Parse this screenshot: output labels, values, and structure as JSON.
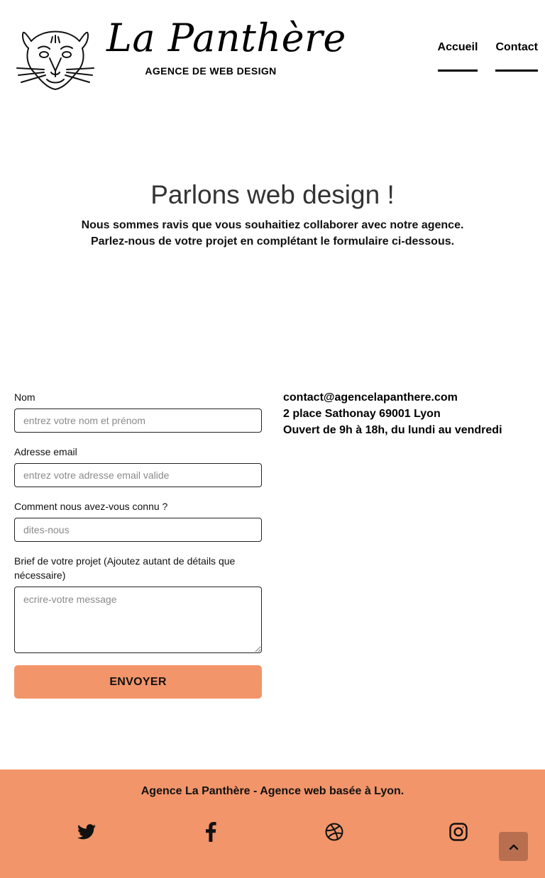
{
  "header": {
    "brand_name": "La Panthère",
    "brand_tagline": "AGENCE DE WEB DESIGN",
    "logo_icon": "panther-head-icon",
    "nav": [
      {
        "label": "Accueil"
      },
      {
        "label": "Contact"
      }
    ]
  },
  "hero": {
    "title": "Parlons web design !",
    "line1": "Nous sommes ravis que vous souhaitiez collaborer avec notre agence.",
    "line2": "Parlez-nous de votre projet en complétant le formulaire ci-dessous."
  },
  "form": {
    "name_label": "Nom",
    "name_placeholder": "entrez votre nom et prénom",
    "email_label": "Adresse email",
    "email_placeholder": "entrez votre adresse email valide",
    "source_label": "Comment nous avez-vous connu ?",
    "source_placeholder": "dites-nous",
    "brief_label": "Brief de votre projet (Ajoutez autant de détails que nécessaire)",
    "brief_placeholder": "ecrire-votre message",
    "submit_label": "ENVOYER"
  },
  "contact_info": {
    "email": "contact@agencelapanthere.com",
    "address": "2 place Sathonay 69001 Lyon",
    "hours": "Ouvert de 9h à 18h, du lundi au vendredi"
  },
  "footer": {
    "text": "Agence La Panthère - Agence web basée à Lyon.",
    "social_icons": [
      "twitter-icon",
      "facebook-icon",
      "dribbble-icon",
      "instagram-icon"
    ],
    "back_to_top_icon": "chevron-up-icon"
  },
  "colors": {
    "accent": "#f2956a",
    "back_to_top": "#b86f50",
    "text": "#000000"
  }
}
